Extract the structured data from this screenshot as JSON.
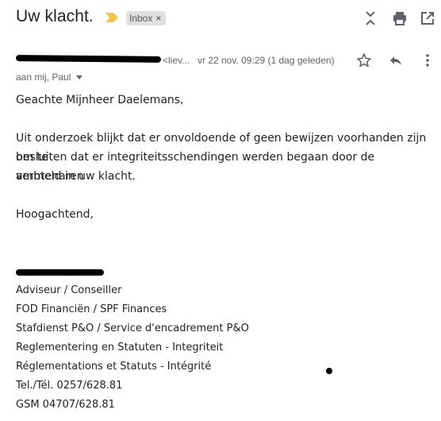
{
  "subject": "Uw klacht.",
  "label": {
    "text": "Inbox",
    "remove": "×"
  },
  "sender": {
    "email_fragment": "<liev...",
    "date": "vr 22 nov. 09:29 (1 dag geleden)"
  },
  "recipients": "aan mij, Paul",
  "body": {
    "greeting": "Geachte Mijnheer Daelemans,",
    "paragraph": [
      "Uit onderzoek blijkt dat er onvoldoende of geen bewijzen voorhanden zijn om te",
      "besluiten dat er integriteitsschendingen werden begaan door de ambtenaren",
      "vermeld in uw klacht."
    ],
    "closing": "Hoogachtend,"
  },
  "signature": [
    "Adviseur / Conseiller",
    "FOD Financiën / SPF Finances",
    "Stafdienst P&O / Service d'encadrement P&O",
    "Reglementering en Statuten - Integriteit",
    "Réglementations et Statuts - Intégrité",
    "Tel./Tél.  0257/628.81",
    "GSM 04707/628.81"
  ],
  "colors": {
    "importance": "#f4c542",
    "icon": "#5f6368"
  },
  "icons": [
    "expand-collapse-icon",
    "print-icon",
    "open-new-window-icon",
    "star-icon",
    "reply-icon",
    "more-vert-icon",
    "importance-marker-icon"
  ]
}
